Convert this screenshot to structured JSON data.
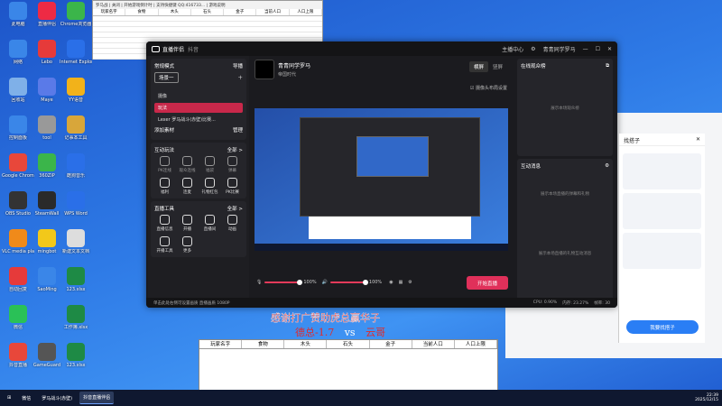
{
  "desktop_icons": [
    {
      "label": "此电脑",
      "color": "#3a86e8"
    },
    {
      "label": "直播伴侣",
      "color": "#ee2a44"
    },
    {
      "label": "Chrome浏览器",
      "color": "#3bb54a"
    },
    {
      "label": "网络",
      "color": "#3a86e8"
    },
    {
      "label": "Lebo",
      "color": "#e63a3a"
    },
    {
      "label": "Internet Explorer",
      "color": "#2a6fe8"
    },
    {
      "label": "回收站",
      "color": "#7fb0e8"
    },
    {
      "label": "Maye",
      "color": "#5a7ae8"
    },
    {
      "label": "YY语音",
      "color": "#f2b21a"
    },
    {
      "label": "控制面板",
      "color": "#3a86e8"
    },
    {
      "label": "tool",
      "color": "#999999"
    },
    {
      "label": "记事本工具",
      "color": "#d8a63a"
    },
    {
      "label": "Google Chrome",
      "color": "#e8473a"
    },
    {
      "label": "360ZIP",
      "color": "#3bb54a"
    },
    {
      "label": "酷狗音乐",
      "color": "#2a6fe8"
    },
    {
      "label": "OBS Studio",
      "color": "#333333"
    },
    {
      "label": "SteamWall",
      "color": "#2a2a2a"
    },
    {
      "label": "WPS Word",
      "color": "#2a6fe8"
    },
    {
      "label": "VLC media player",
      "color": "#f08a1a"
    },
    {
      "label": "mingbot",
      "color": "#f2c81a"
    },
    {
      "label": "新建文本文档",
      "color": "#dddddd"
    },
    {
      "label": "自动回复",
      "color": "#e63a3a"
    },
    {
      "label": "SaoMing",
      "color": "#3a86e8"
    },
    {
      "label": "123.xlsx",
      "color": "#1e8a45"
    },
    {
      "label": "微信",
      "color": "#2ac157"
    },
    {
      "label": "",
      "color": ""
    },
    {
      "label": "工作簿.xlsx",
      "color": "#1e8a45"
    },
    {
      "label": "抖音直播",
      "color": "#e8473a"
    },
    {
      "label": "GameGuard",
      "color": "#555555"
    },
    {
      "label": "123.xlsx",
      "color": "#1e8a45"
    }
  ],
  "top_sheet": {
    "toolbar_text": "罗马战 | 关闭 | 开始游戏倒计时 | 支持快捷键 QQ:416733... | 游戏说明",
    "columns": [
      "玩家名字",
      "食物",
      "木头",
      "石头",
      "金子",
      "当前人口",
      "人口上限"
    ]
  },
  "main_window": {
    "app_title": "直播伴侣",
    "app_subtitle": "抖音",
    "header_links": [
      "主播中心"
    ],
    "user_name": "青青同学罗马",
    "scene_mode": "常规模式",
    "import_label": "导播",
    "scene_tab": "场景一",
    "scenes": [
      "摄像",
      "玩法",
      "Lexer 罗马战斗(赤壁)比赛..."
    ],
    "add_material": "添加素材",
    "manage": "管理",
    "streamer_name": "青青同学罗马",
    "streamer_sub": "帝国时代",
    "tab_landscape": "横屏",
    "tab_portrait": "竖屏",
    "camera_layout": "摄像头布局设置",
    "interactive_section": "互动玩法",
    "interactive_more": "全部 >",
    "interactive_items": [
      "PK连线",
      "观众连线",
      "福袋",
      "弹幕",
      "福利",
      "连麦",
      "礼物红包",
      "PK比赛"
    ],
    "tools_section": "直播工具",
    "tools_more": "全部 >",
    "tools_items": [
      "直播信息",
      "开播",
      "直播间",
      "动画",
      "开播工具",
      "更多"
    ],
    "mic_volume": "100%",
    "speaker_volume": "100%",
    "start_button": "开始直播",
    "status_text": "单击此处右侧可设置画质 直播画质 1080P",
    "cpu": "CPU: 0.90%",
    "memory": "内存: 23.27%",
    "fps": "帧率: 30",
    "viewers_title": "在线观众榜",
    "viewers_empty": "展示本场观众榜",
    "messages_title": "互动消息",
    "messages_empty": "展示本场直播的弹幕和礼物",
    "gifts_empty": "展示本场直播的礼物互动消息"
  },
  "side_panel": {
    "title": "找搭子",
    "button": "我要找搭子"
  },
  "overlay": {
    "line1": "感谢打广赞助虎总赢华子",
    "left_score": "德总-1.7",
    "vs": "vs",
    "right_score": "云哥"
  },
  "bottom_table": {
    "columns": [
      "玩家名字",
      "食物",
      "木头",
      "石头",
      "金子",
      "当前人口",
      "人口上限"
    ]
  },
  "taskbar": {
    "items": [
      "微信",
      "罗马战斗(赤壁)",
      "抖音直播伴侣"
    ],
    "time": "22:39",
    "date": "2025/12/15"
  }
}
